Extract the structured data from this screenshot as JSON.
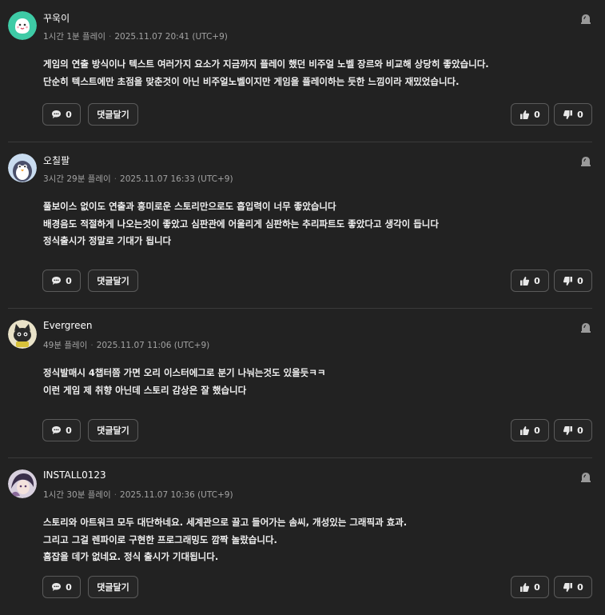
{
  "reviews": [
    {
      "author": "꾸욱이",
      "playtime": "1시간 1분 플레이",
      "date": "2025.11.07 20:41 (UTC+9)",
      "lines": [
        "게임의 연출 방식이나 텍스트 여러가지 요소가 지금까지 플레이 했던 비주얼 노벨 장르와 비교해 상당히 좋았습니다.",
        "단순히 텍스트에만 초점을 맞춘것이 아닌 비주얼노벨이지만 게임을 플레이하는 듯한 느낌이라 재밌었습니다."
      ],
      "comment_count": "0",
      "reply_label": "댓글달기",
      "likes": "0",
      "dislikes": "0",
      "avatar_icon": "teal-blob-avatar-icon"
    },
    {
      "author": "오칠팔",
      "playtime": "3시간 29분 플레이",
      "date": "2025.11.07 16:33 (UTC+9)",
      "lines": [
        "풀보이스 없이도 연출과 흥미로운 스토리만으로도 흡입력이 너무 좋았습니다",
        "배경음도 적절하게 나오는것이 좋았고 심판관에 어울리게 심판하는 추리파트도 좋았다고 생각이 듭니다",
        "정식출시가 정말로 기대가 됩니다"
      ],
      "comment_count": "0",
      "reply_label": "댓글달기",
      "likes": "0",
      "dislikes": "0",
      "avatar_icon": "penguin-avatar-icon"
    },
    {
      "author": "Evergreen",
      "playtime": "49분 플레이",
      "date": "2025.11.07 11:06 (UTC+9)",
      "lines": [
        "정식발매시 4챕터쯤 가면 오리 이스터에그로 분기 나눠는것도 있을듯ㅋㅋ",
        "이런 게임 제 취향 아닌데 스토리 감상은 잘 했습니다"
      ],
      "comment_count": "0",
      "reply_label": "댓글달기",
      "likes": "0",
      "dislikes": "0",
      "avatar_icon": "cat-avatar-icon"
    },
    {
      "author": "INSTALL0123",
      "playtime": "1시간 30분 플레이",
      "date": "2025.11.07 10:36 (UTC+9)",
      "lines": [
        "스토리와 아트워크 모두 대단하네요. 세계관으로 끌고 들어가는 솜씨, 개성있는 그래픽과 효과.",
        "그리고 그걸 렌파이로 구현한 프로그래밍도 깜짝 놀랐습니다.",
        "흠잡을 데가 없네요. 정식 출시가 기대됩니다."
      ],
      "comment_count": "0",
      "reply_label": "댓글달기",
      "likes": "0",
      "dislikes": "0",
      "avatar_icon": "anime-character-avatar-icon"
    }
  ],
  "icons": {
    "report": "siren-report-icon",
    "comment": "speech-bubble-icon",
    "like": "thumbs-up-icon",
    "dislike": "thumbs-down-icon"
  },
  "colors": {
    "background": "#222222",
    "divider": "#3a3a3a",
    "button_border": "#5a5a5a",
    "avatar_teal": "#3ecba6"
  }
}
